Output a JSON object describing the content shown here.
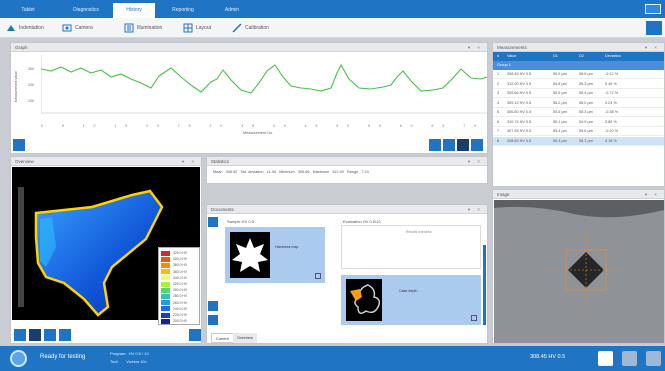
{
  "nav": {
    "tabs": [
      "Tablet",
      "Diagnostics",
      "History",
      "Reporting",
      "Admin"
    ],
    "active_index": 2
  },
  "toolbar": {
    "items": [
      "Indentation",
      "Camera",
      "Illumination",
      "Layout",
      "Calibration"
    ]
  },
  "graph": {
    "title": "Graph",
    "ylabel": "Measurement Value",
    "xlabel": "Measurement No.",
    "ytick_labels": [
      "300",
      "200",
      "100"
    ]
  },
  "results": {
    "title": "Measurements",
    "columns": [
      "#",
      "Value",
      "D1",
      "D2",
      "Deviation"
    ],
    "group_label": "Group 1",
    "rows": [
      [
        "1",
        "308.45 HV 0.5",
        "55.5 µm",
        "58.5 µm",
        "-0.12 %"
      ],
      [
        "2",
        "312.90 HV 0.5",
        "54.8 µm",
        "55.3 µm",
        "0.46 %"
      ],
      [
        "3",
        "305.66 HV 0.5",
        "55.9 µm",
        "55.4 µm",
        "-0.71 %"
      ],
      [
        "4",
        "309.12 HV 0.5",
        "55.2 µm",
        "55.0 µm",
        "0.24 %"
      ],
      [
        "5",
        "306.80 HV 0.5",
        "55.6 µm",
        "55.3 µm",
        "-0.38 %"
      ],
      [
        "6",
        "310.74 HV 0.5",
        "55.1 µm",
        "54.9 µm",
        "0.85 %"
      ],
      [
        "7",
        "307.55 HV 0.5",
        "55.4 µm",
        "55.6 µm",
        "-0.20 %"
      ],
      [
        "8",
        "308.82 HV 0.5",
        "55.3 µm",
        "55.1 µm",
        "0.18 %"
      ]
    ],
    "selected_row": 7
  },
  "overview": {
    "title": "Overview",
    "legend_labels": [
      "420.0 HV",
      "400.0 HV",
      "380.0 HV",
      "360.0 HV",
      "340.0 HV",
      "320.0 HV",
      "300.0 HV",
      "280.0 HV",
      "260.0 HV",
      "240.0 HV",
      "220.0 HV",
      "200.0 HV"
    ]
  },
  "info": {
    "title": "Statistics",
    "text": "Mean   308.92   Std. deviation   ±1.94   Minimum   305.66   Maximum   312.90   Range   7.24"
  },
  "documents": {
    "title": "Documents",
    "item1_title": "Sample HV 0.5",
    "item1_caption": "Hardness map",
    "item2_title": "Evaluation HV 0.5/10",
    "item2_sub": "Results overview",
    "item2_caption": "Case depth",
    "tabs": [
      "Current",
      "Overview"
    ]
  },
  "image": {
    "title": "Image"
  },
  "status": {
    "ready_text": "Ready for testing",
    "line1": "Program:  HV 0.5 / 10",
    "line2": "Tool:       Vickers 40×",
    "value": "308.45 HV 0.5"
  }
}
